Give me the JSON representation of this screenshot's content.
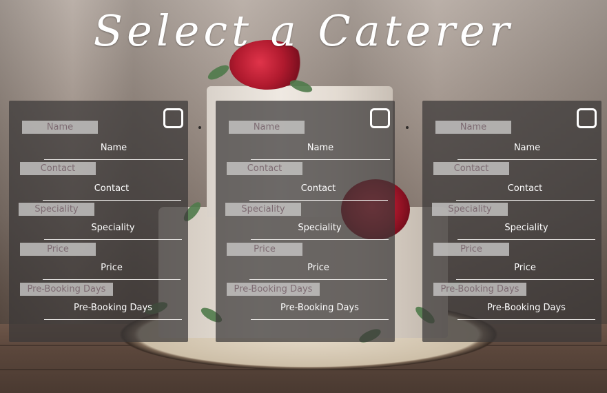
{
  "page": {
    "title": "Select a Caterer"
  },
  "caterers": [
    {
      "selected": false,
      "fields": [
        {
          "label": "Name",
          "value": "Name"
        },
        {
          "label": "Contact",
          "value": "Contact"
        },
        {
          "label": "Speciality",
          "value": "Speciality"
        },
        {
          "label": "Price",
          "value": "Price"
        },
        {
          "label": "Pre-Booking Days",
          "value": "Pre-Booking Days"
        }
      ]
    },
    {
      "selected": false,
      "fields": [
        {
          "label": "Name",
          "value": "Name"
        },
        {
          "label": "Contact",
          "value": "Contact"
        },
        {
          "label": "Speciality",
          "value": "Speciality"
        },
        {
          "label": "Price",
          "value": "Price"
        },
        {
          "label": "Pre-Booking Days",
          "value": "Pre-Booking Days"
        }
      ]
    },
    {
      "selected": false,
      "fields": [
        {
          "label": "Name",
          "value": "Name"
        },
        {
          "label": "Contact",
          "value": "Contact"
        },
        {
          "label": "Speciality",
          "value": "Speciality"
        },
        {
          "label": "Price",
          "value": "Price"
        },
        {
          "label": "Pre-Booking Days",
          "value": "Pre-Booking Days"
        }
      ]
    }
  ]
}
